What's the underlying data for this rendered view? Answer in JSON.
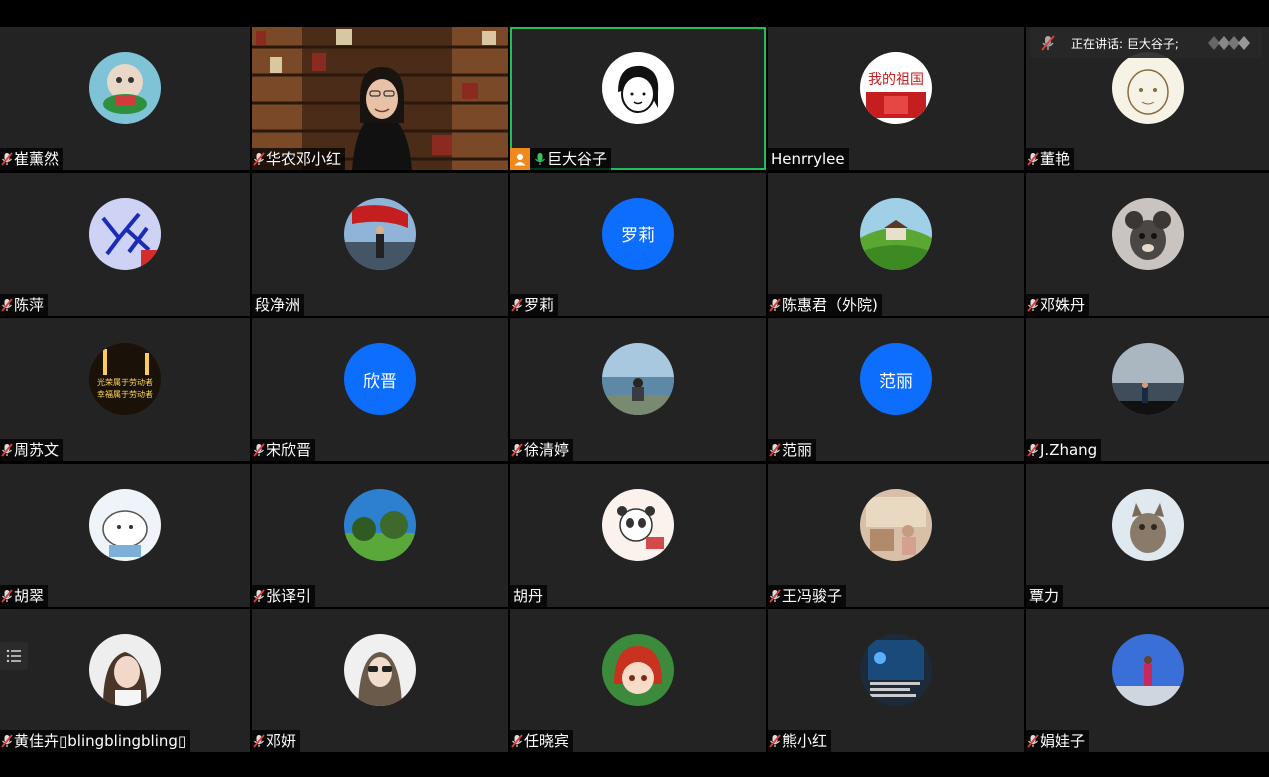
{
  "speaking": {
    "label": "正在讲话: 巨大谷子;"
  },
  "participants": [
    {
      "name": "崔薰然",
      "muted": true,
      "avatar": "mushroom-cartoon-avatar"
    },
    {
      "name": "华农邓小红",
      "muted": true,
      "video": true
    },
    {
      "name": "巨大谷子",
      "muted": false,
      "host": true,
      "active": true,
      "avatar": "girl-line-drawing-avatar"
    },
    {
      "name": "Henrrylee",
      "muted": null,
      "avatar": "flag-text-avatar"
    },
    {
      "name": "董艳",
      "muted": true,
      "avatar": "sketch-face-avatar"
    },
    {
      "name": "陈萍",
      "muted": true,
      "avatar": "blue-doodle-avatar"
    },
    {
      "name": "段净洲",
      "muted": null,
      "avatar": "flag-person-avatar"
    },
    {
      "name": "罗莉",
      "muted": true,
      "initials": "罗莉"
    },
    {
      "name": "陈惠君（外院)",
      "muted": true,
      "avatar": "green-hills-avatar"
    },
    {
      "name": "邓姝丹",
      "muted": true,
      "avatar": "dog-avatar"
    },
    {
      "name": "周苏文",
      "muted": true,
      "avatar": "night-slogan-avatar"
    },
    {
      "name": "宋欣晋",
      "muted": true,
      "initials": "欣晋"
    },
    {
      "name": "徐清婷",
      "muted": true,
      "avatar": "lake-girl-avatar"
    },
    {
      "name": "范丽",
      "muted": true,
      "initials": "范丽"
    },
    {
      "name": "J.Zhang",
      "muted": true,
      "avatar": "sea-person-avatar"
    },
    {
      "name": "胡翠",
      "muted": true,
      "avatar": "cartoon-cat-avatar"
    },
    {
      "name": "张译引",
      "muted": true,
      "avatar": "park-trees-avatar"
    },
    {
      "name": "胡丹",
      "muted": null,
      "avatar": "panda-sticker-avatar"
    },
    {
      "name": "王冯骏子",
      "muted": true,
      "avatar": "cafe-room-avatar"
    },
    {
      "name": "覃力",
      "muted": null,
      "avatar": "cat-photo-avatar"
    },
    {
      "name": "黄佳卉▯blingblingbling▯",
      "muted": true,
      "avatar": "girl-portrait-avatar"
    },
    {
      "name": "邓妍",
      "muted": true,
      "avatar": "sunglasses-girl-avatar"
    },
    {
      "name": "任晓宾",
      "muted": true,
      "avatar": "anime-redhair-avatar"
    },
    {
      "name": "熊小红",
      "muted": true,
      "avatar": "phone-screen-avatar"
    },
    {
      "name": "娟娃子",
      "muted": true,
      "avatar": "desert-person-avatar"
    }
  ],
  "colors": {
    "tile_bg": "#232323",
    "initials_bg": "#0d6efd",
    "active_border": "#1fbf5a",
    "host_badge": "#f08a1c",
    "muted_mic": "#e03b3b",
    "live_mic": "#3cc25a"
  }
}
